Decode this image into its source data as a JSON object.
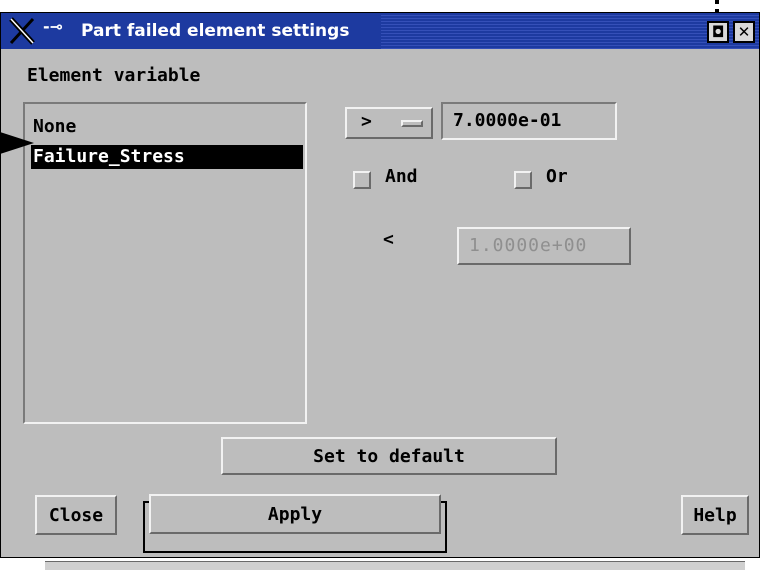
{
  "window": {
    "title": "Part failed element settings",
    "title_icons": [
      "x-window-logo-icon",
      "pin-icon"
    ],
    "title_buttons": [
      {
        "name": "maximize-icon",
        "glyph": "◘"
      },
      {
        "name": "close-icon",
        "glyph": "✕"
      }
    ]
  },
  "element_variable": {
    "label": "Element variable",
    "items": [
      {
        "label": "None",
        "selected": false
      },
      {
        "label": "Failure_Stress",
        "selected": true
      }
    ]
  },
  "criteria": {
    "operator": ">",
    "value1": "7.0000e-01",
    "and_label": "And",
    "or_label": "Or",
    "and_checked": false,
    "or_checked": false,
    "lower_operator": "<",
    "value2": "1.0000e+00"
  },
  "buttons": {
    "set_default": "Set to default",
    "close": "Close",
    "apply": "Apply",
    "help": "Help"
  },
  "colors": {
    "titlebar": "#1d3aa0",
    "dialog_bg": "#bdbdbd",
    "selection": "#000000"
  }
}
